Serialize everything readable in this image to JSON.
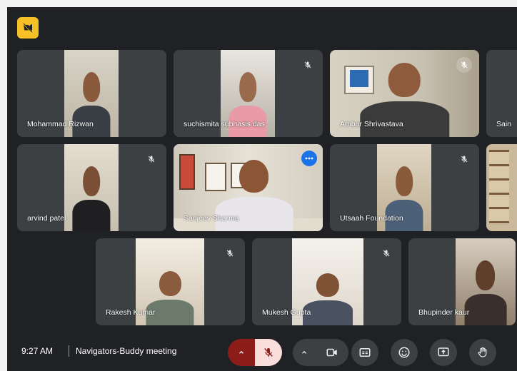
{
  "indicators": {
    "camera_off_badge_icon": "videocam-off-icon",
    "badge_color": "#f6c026"
  },
  "participants": [
    {
      "name": "Mohammad Rizwan",
      "muted": false,
      "active": false
    },
    {
      "name": "suchismita subhasis das",
      "muted": true,
      "active": false
    },
    {
      "name": "Ambar Shrivastava",
      "muted": true,
      "active": false
    },
    {
      "name": "Sain",
      "muted": false,
      "active": false
    },
    {
      "name": "arvind patel",
      "muted": true,
      "active": false
    },
    {
      "name": "Sanjeev Sharma",
      "muted": false,
      "active": true
    },
    {
      "name": "Utsaah Foundation",
      "muted": true,
      "active": false
    },
    {
      "name": "",
      "muted": false,
      "active": false
    },
    {
      "name": "Rakesh Kumar",
      "muted": true,
      "active": false
    },
    {
      "name": "Mukesh Gupta",
      "muted": true,
      "active": false
    },
    {
      "name": "Bhupinder kaur",
      "muted": false,
      "active": false
    }
  ],
  "bottom_bar": {
    "time": "9:27 AM",
    "meeting_name": "Navigators-Buddy meeting",
    "controls": [
      {
        "id": "mic-options",
        "icon": "chevron-up-icon"
      },
      {
        "id": "mic",
        "icon": "mic-off-icon",
        "state": "muted"
      },
      {
        "id": "camera-options",
        "icon": "chevron-up-icon"
      },
      {
        "id": "camera",
        "icon": "videocam-icon"
      },
      {
        "id": "captions",
        "icon": "closed-captions-icon"
      },
      {
        "id": "reactions",
        "icon": "emoji-icon"
      },
      {
        "id": "present",
        "icon": "present-screen-icon"
      },
      {
        "id": "raise-hand",
        "icon": "raise-hand-icon"
      }
    ]
  },
  "colors": {
    "background": "#202124",
    "tile": "#3c4043",
    "active_outline": "#8ab4f8",
    "mic_muted_bg": "#f9dedc",
    "mic_chevron_bg": "#8c1d18",
    "more_button": "#1a73e8"
  }
}
